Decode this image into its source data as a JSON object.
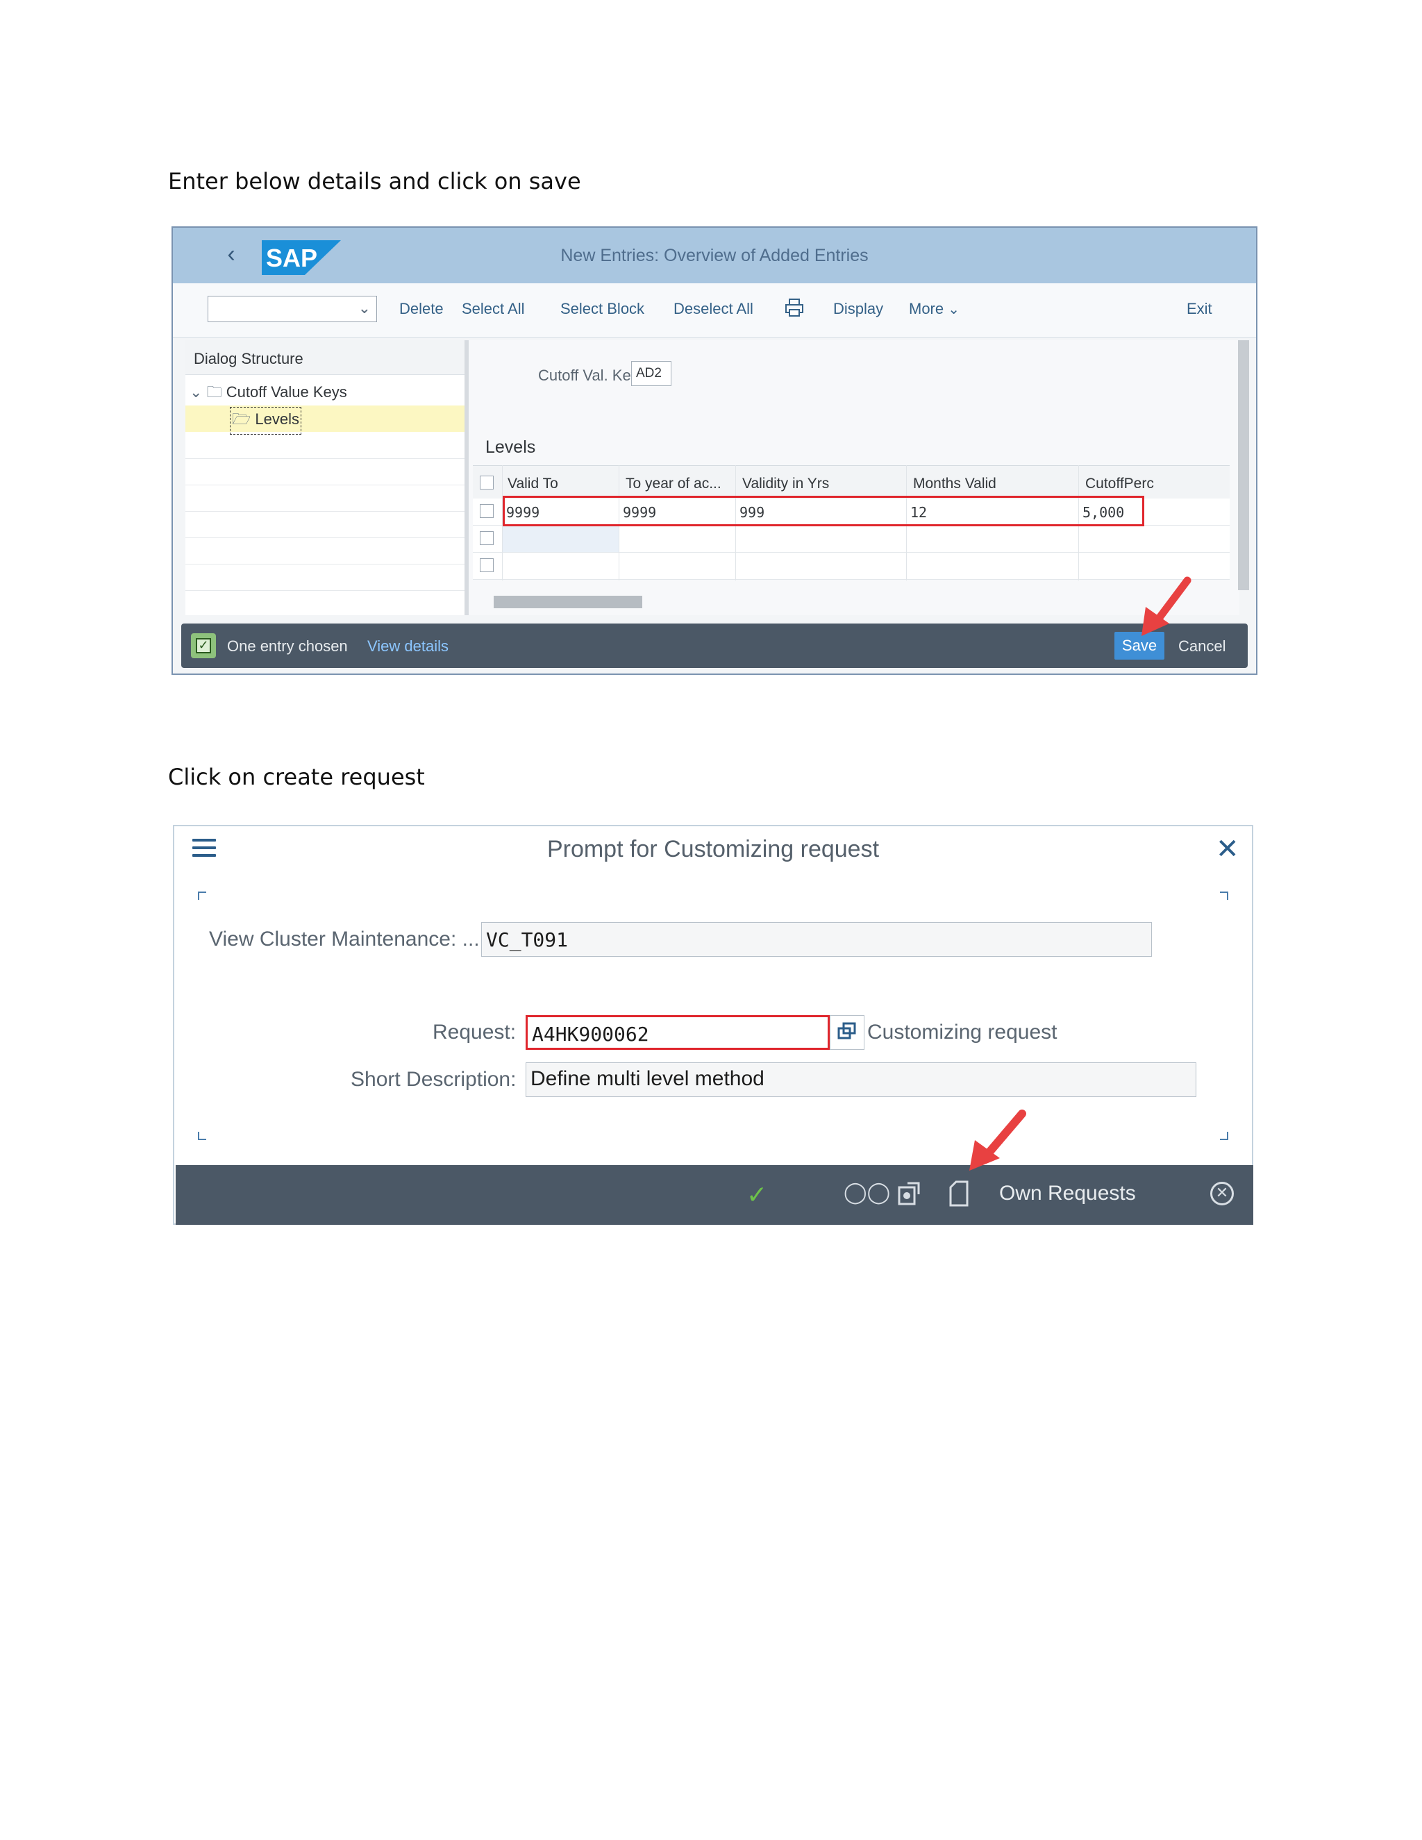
{
  "captions": {
    "step1": "Enter below details and click on save",
    "step2": "Click on create request"
  },
  "screen1": {
    "header": {
      "logo": "SAP",
      "title": "New Entries: Overview of Added Entries"
    },
    "toolbar": {
      "dropdown_value": "",
      "buttons": [
        "Delete",
        "Select All",
        "Select Block",
        "Deselect All",
        "Display",
        "More",
        "Exit"
      ],
      "print_icon": "print-icon"
    },
    "dialog_structure": {
      "title": "Dialog Structure",
      "items": [
        {
          "label": "Cutoff Value Keys",
          "icon": "folder-icon",
          "expanded": true
        },
        {
          "label": "Levels",
          "icon": "folder-open-icon",
          "selected": true
        }
      ]
    },
    "detail": {
      "key_label": "Cutoff Val. Key:",
      "key_value": "AD2",
      "section_title": "Levels",
      "columns": [
        "Valid To",
        "To year of ac...",
        "Validity in Yrs",
        "Months Valid",
        "CutoffPerc"
      ],
      "rows": [
        [
          "9999",
          "9999",
          "999",
          "12",
          "5,000"
        ],
        [
          "",
          "",
          "",
          "",
          ""
        ],
        [
          "",
          "",
          "",
          "",
          ""
        ]
      ]
    },
    "footer": {
      "message": "One entry chosen",
      "link": "View details",
      "save": "Save",
      "cancel": "Cancel"
    },
    "colors": {
      "header": "#a9c6e0",
      "footer": "#4b5866",
      "highlight": "#e0262d",
      "save": "#3f8fd6"
    }
  },
  "screen2": {
    "title": "Prompt for Customizing request",
    "fields": {
      "view_label": "View Cluster Maintenance: ...",
      "view_value": "VC_T091",
      "request_label": "Request:",
      "request_value": "A4HK900062",
      "request_desc": "Customizing request",
      "short_label": "Short Description:",
      "short_value": "Define multi level method"
    },
    "footer": {
      "icons": [
        "checkmark-icon",
        "glasses-icon",
        "create-request-icon",
        "document-icon"
      ],
      "own_requests": "Own Requests",
      "cancel_icon": "cancel-circle-icon"
    }
  }
}
